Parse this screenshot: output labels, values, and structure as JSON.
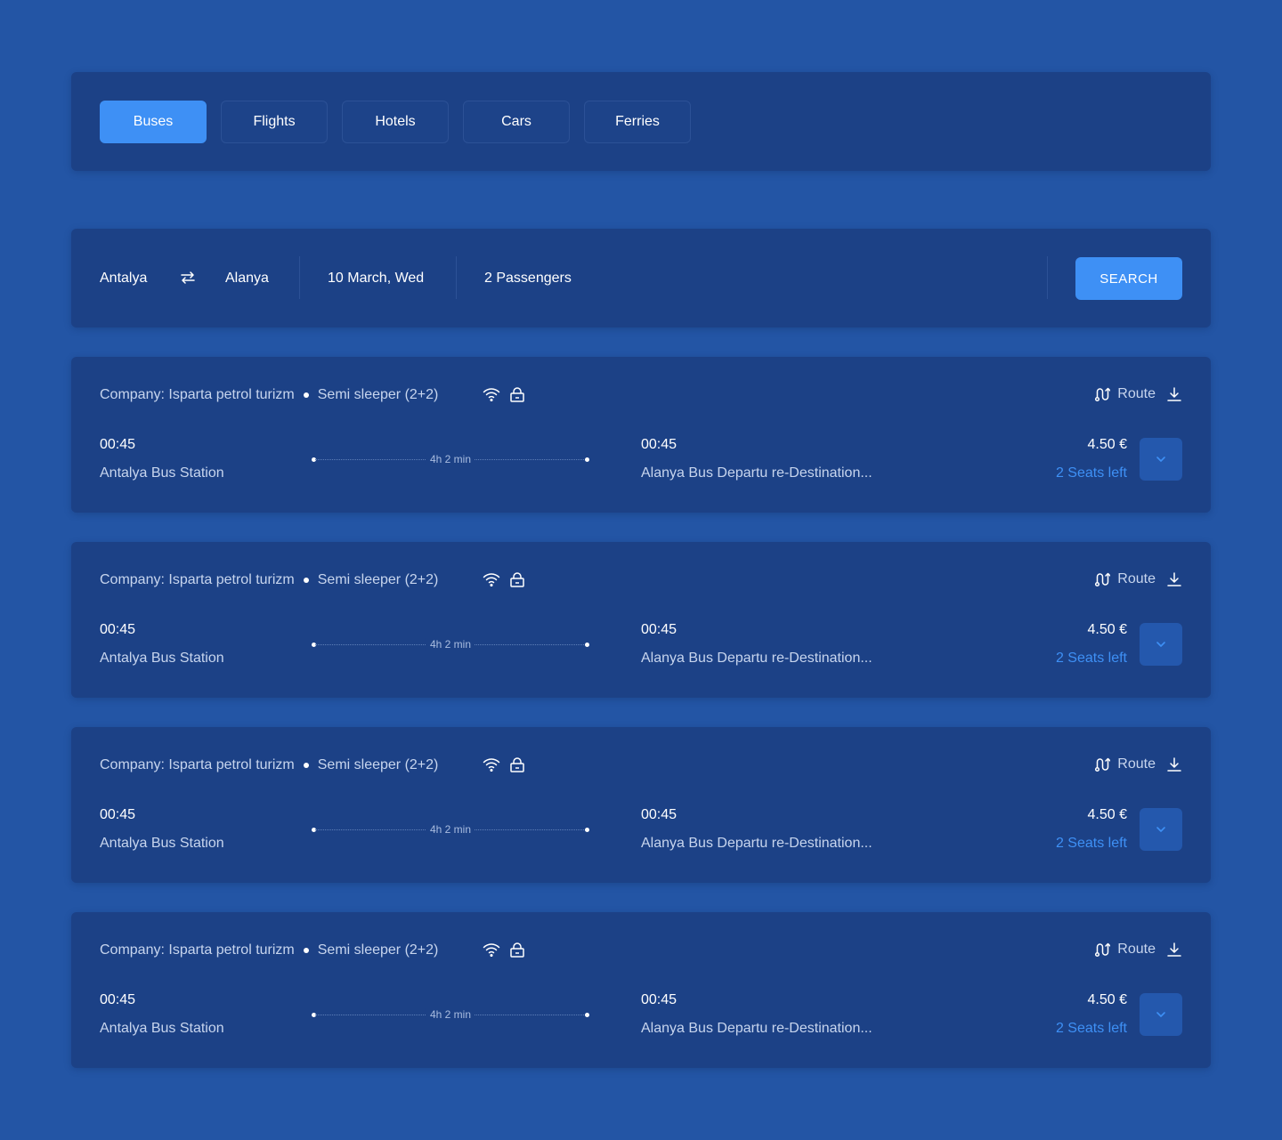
{
  "tabs": [
    {
      "label": "Buses",
      "active": true
    },
    {
      "label": "Flights",
      "active": false
    },
    {
      "label": "Hotels",
      "active": false
    },
    {
      "label": "Cars",
      "active": false
    },
    {
      "label": "Ferries",
      "active": false
    }
  ],
  "search": {
    "from": "Antalya",
    "to": "Alanya",
    "date": "10 March, Wed",
    "passengers": "2 Passengers",
    "button_label": "SEARCH"
  },
  "results": [
    {
      "company": "Company: Isparta petrol turizm",
      "seat_type": "Semi sleeper (2+2)",
      "route_label": "Route",
      "depart_time": "00:45",
      "depart_station": "Antalya Bus Station",
      "duration": "4h 2 min",
      "arrive_time": "00:45",
      "arrive_station": "Alanya Bus Departu re-Destination...",
      "price": "4.50 €",
      "seats_left": "2 Seats left"
    },
    {
      "company": "Company: Isparta petrol turizm",
      "seat_type": "Semi sleeper (2+2)",
      "route_label": "Route",
      "depart_time": "00:45",
      "depart_station": "Antalya Bus Station",
      "duration": "4h 2 min",
      "arrive_time": "00:45",
      "arrive_station": "Alanya Bus Departu re-Destination...",
      "price": "4.50 €",
      "seats_left": "2 Seats left"
    },
    {
      "company": "Company: Isparta petrol turizm",
      "seat_type": "Semi sleeper (2+2)",
      "route_label": "Route",
      "depart_time": "00:45",
      "depart_station": "Antalya Bus Station",
      "duration": "4h 2 min",
      "arrive_time": "00:45",
      "arrive_station": "Alanya Bus Departu re-Destination...",
      "price": "4.50 €",
      "seats_left": "2 Seats left"
    },
    {
      "company": "Company: Isparta petrol turizm",
      "seat_type": "Semi sleeper (2+2)",
      "route_label": "Route",
      "depart_time": "00:45",
      "depart_station": "Antalya Bus Station",
      "duration": "4h 2 min",
      "arrive_time": "00:45",
      "arrive_station": "Alanya Bus Departu re-Destination...",
      "price": "4.50 €",
      "seats_left": "2 Seats left"
    }
  ],
  "icons": {
    "swap": "swap-arrows-icon",
    "wifi": "wifi-icon",
    "lock": "lock-icon",
    "route": "route-icon",
    "download": "download-icon",
    "expand": "chevron-down-icon"
  },
  "colors": {
    "background": "#2355a5",
    "panel": "#1c4186",
    "accent": "#3e90f5",
    "muted_text": "#c7d5ee"
  }
}
